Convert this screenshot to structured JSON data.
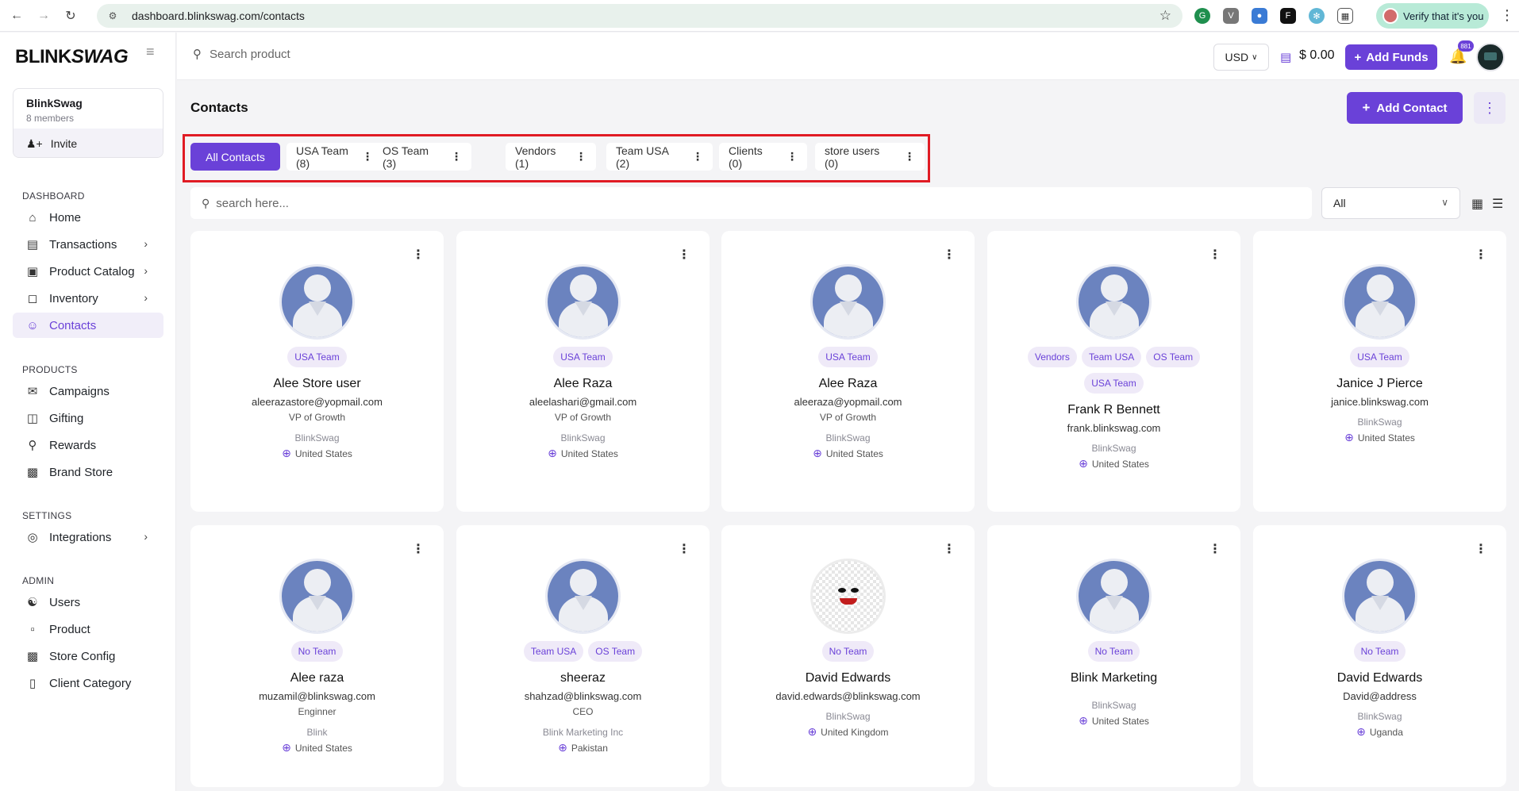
{
  "browser": {
    "url": "dashboard.blinkswag.com/contacts",
    "verify_label": "Verify that it's you"
  },
  "sidebar": {
    "logo_prefix": "BLINK",
    "logo_suffix": "SWAG",
    "org": {
      "name": "BlinkSwag",
      "members": "8 members",
      "invite_label": "Invite"
    },
    "sections": {
      "dashboard": "DASHBOARD",
      "products": "PRODUCTS",
      "settings": "SETTINGS",
      "admin": "ADMIN"
    },
    "items": {
      "home": "Home",
      "transactions": "Transactions",
      "product_catalog": "Product Catalog",
      "inventory": "Inventory",
      "contacts": "Contacts",
      "campaigns": "Campaigns",
      "gifting": "Gifting",
      "rewards": "Rewards",
      "brand_store": "Brand Store",
      "integrations": "Integrations",
      "users": "Users",
      "product": "Product",
      "store_config": "Store Config",
      "client_category": "Client Category"
    }
  },
  "topbar": {
    "search_placeholder": "Search product",
    "currency": "USD",
    "balance": "$ 0.00",
    "add_funds_label": "Add Funds",
    "notification_count": "881"
  },
  "main": {
    "title": "Contacts",
    "add_contact_label": "Add Contact",
    "tabs": [
      {
        "label": "All Contacts",
        "active": true
      },
      {
        "label": "USA Team (8)"
      },
      {
        "label": "OS Team (3)"
      },
      {
        "label": "Vendors (1)"
      },
      {
        "label": "Team USA (2)"
      },
      {
        "label": "Clients (0)"
      },
      {
        "label": "store users (0)"
      }
    ],
    "search_placeholder": "search here...",
    "filter_value": "All"
  },
  "contacts": [
    {
      "tags": [
        "USA Team"
      ],
      "name": "Alee Store user",
      "email": "aleerazastore@yopmail.com",
      "role": "VP of Growth",
      "company": "BlinkSwag",
      "country": "United States"
    },
    {
      "tags": [
        "USA Team"
      ],
      "name": "Alee Raza",
      "email": "aleelashari@gmail.com",
      "role": "VP of Growth",
      "company": "BlinkSwag",
      "country": "United States"
    },
    {
      "tags": [
        "USA Team"
      ],
      "name": "Alee Raza",
      "email": "aleeraza@yopmail.com",
      "role": "VP of Growth",
      "company": "BlinkSwag",
      "country": "United States"
    },
    {
      "tags": [
        "Vendors",
        "Team USA",
        "OS Team",
        "USA Team"
      ],
      "name": "Frank R Bennett",
      "email": "frank.blinkswag.com",
      "role": "",
      "company": "BlinkSwag",
      "country": "United States"
    },
    {
      "tags": [
        "USA Team"
      ],
      "name": "Janice J Pierce",
      "email": "janice.blinkswag.com",
      "role": "",
      "company": "BlinkSwag",
      "country": "United States"
    },
    {
      "tags": [
        "No Team"
      ],
      "name": "Alee raza",
      "email": "muzamil@blinkswag.com",
      "role": "Enginner",
      "company": "Blink",
      "country": "United States"
    },
    {
      "tags": [
        "Team USA",
        "OS Team"
      ],
      "name": "sheeraz",
      "email": "shahzad@blinkswag.com",
      "role": "CEO",
      "company": "Blink Marketing Inc",
      "country": "Pakistan"
    },
    {
      "tags": [
        "No Team"
      ],
      "name": "David Edwards",
      "email": "david.edwards@blinkswag.com",
      "role": "",
      "company": "BlinkSwag",
      "country": "United Kingdom",
      "avatar": "joker"
    },
    {
      "tags": [
        "No Team"
      ],
      "name": "Blink Marketing",
      "email": "",
      "role": "",
      "company": "BlinkSwag",
      "country": "United States"
    },
    {
      "tags": [
        "No Team"
      ],
      "name": "David Edwards",
      "email": "David@address",
      "role": "",
      "company": "BlinkSwag",
      "country": "Uganda"
    }
  ]
}
